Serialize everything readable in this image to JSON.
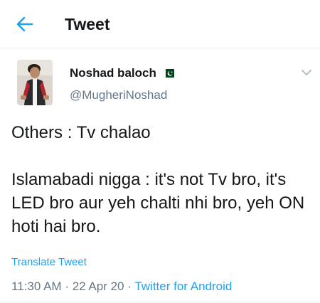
{
  "header": {
    "title": "Tweet",
    "back_icon": "arrow-left-icon"
  },
  "author": {
    "display_name": "Noshad baloch",
    "handle": "@MugheriNoshad",
    "flag_icon": "pakistan-flag-icon"
  },
  "tweet": {
    "text": "Others : Tv chalao\n\nIslamabadi nigga : it's not Tv bro, it's LED bro aur yeh chalti nhi bro, yeh ON hoti hai bro.",
    "translate_label": "Translate Tweet",
    "time": "11:30 AM",
    "separator": "·",
    "date": "22 Apr 20",
    "source": "Twitter for Android"
  },
  "colors": {
    "accent": "#1da1f2",
    "secondary_text": "#657786",
    "primary_text": "#14171a",
    "flag_green": "#01411c"
  }
}
